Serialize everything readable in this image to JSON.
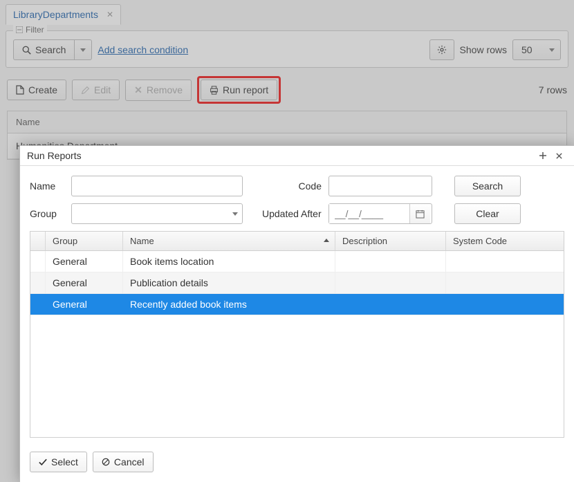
{
  "tab": {
    "label": "LibraryDepartments"
  },
  "filter": {
    "legend": "Filter",
    "search_label": "Search",
    "add_condition": "Add search condition",
    "show_rows_label": "Show rows",
    "show_rows_value": "50"
  },
  "toolbar": {
    "create": "Create",
    "edit": "Edit",
    "remove": "Remove",
    "run_report": "Run report",
    "rows_count": "7 rows"
  },
  "bg_grid": {
    "header": "Name",
    "row1": "Humanities Department"
  },
  "modal": {
    "title": "Run Reports",
    "labels": {
      "name": "Name",
      "code": "Code",
      "group": "Group",
      "updated_after": "Updated After"
    },
    "date_placeholder": "__/__/____",
    "buttons": {
      "search": "Search",
      "clear": "Clear",
      "select": "Select",
      "cancel": "Cancel"
    },
    "grid": {
      "headers": {
        "group": "Group",
        "name": "Name",
        "description": "Description",
        "system_code": "System Code"
      },
      "rows": [
        {
          "group": "General",
          "name": "Book items location",
          "description": "",
          "code": ""
        },
        {
          "group": "General",
          "name": "Publication details",
          "description": "",
          "code": ""
        },
        {
          "group": "General",
          "name": "Recently added book items",
          "description": "",
          "code": ""
        }
      ]
    }
  }
}
